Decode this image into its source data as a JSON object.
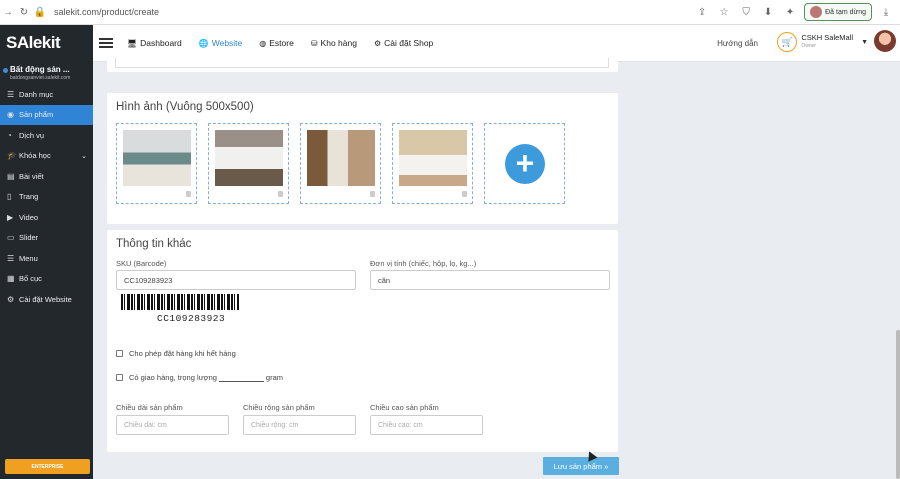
{
  "browser": {
    "url": "salekit.com/product/create",
    "paused_label": "Đã tạm dừng"
  },
  "sidebar": {
    "logo": "SAlekit",
    "site_name": "Bất động sản ...",
    "site_domain": "batdongsanviet.salekit.com",
    "items": [
      {
        "label": "Danh mục",
        "icon": "list-icon"
      },
      {
        "label": "Sản phẩm",
        "icon": "product-icon",
        "active": true
      },
      {
        "label": "Dịch vụ",
        "icon": "service-icon"
      },
      {
        "label": "Khóa học",
        "icon": "course-icon",
        "has_caret": true
      },
      {
        "label": "Bài viết",
        "icon": "post-icon"
      },
      {
        "label": "Trang",
        "icon": "page-icon"
      },
      {
        "label": "Video",
        "icon": "video-icon"
      },
      {
        "label": "Slider",
        "icon": "slider-icon"
      },
      {
        "label": "Menu",
        "icon": "menu-icon"
      },
      {
        "label": "Bố cục",
        "icon": "layout-icon"
      },
      {
        "label": "Cài đặt Website",
        "icon": "gear-icon"
      }
    ],
    "plan_badge": "ENTERPRISE"
  },
  "topnav": {
    "items": [
      {
        "label": "Dashboard",
        "icon": "monitor-icon"
      },
      {
        "label": "Website",
        "icon": "globe-icon",
        "active": true
      },
      {
        "label": "Estore",
        "icon": "globe-icon"
      },
      {
        "label": "Kho hàng",
        "icon": "database-icon"
      },
      {
        "label": "Cài đặt Shop",
        "icon": "gear-icon"
      }
    ],
    "help": "Hướng dẫn",
    "account_name": "CSKH SaleMall",
    "account_role": "Owner"
  },
  "images": {
    "title": "Hình ảnh (Vuông 500x500)"
  },
  "other": {
    "title": "Thông tin khác",
    "sku_label": "SKU (Barcode)",
    "sku_value": "CC109283923",
    "unit_label": "Đơn vị tính (chiếc, hộp, lọ, kg...)",
    "unit_value": "căn",
    "barcode_text": "CC109283923",
    "allow_out_of_stock": "Cho phép đặt hàng khi hết hàng",
    "shipping_prefix": "Có giao hàng, trọng lượng",
    "shipping_unit": "gram",
    "length_label": "Chiều dài sản phẩm",
    "length_placeholder": "Chiều dài: cm",
    "width_label": "Chiều rộng sản phẩm",
    "width_placeholder": "Chiều rộng: cm",
    "height_label": "Chiều cao sản phẩm",
    "height_placeholder": "Chiều cao: cm"
  },
  "save_label": "Lưu sản phẩm »"
}
